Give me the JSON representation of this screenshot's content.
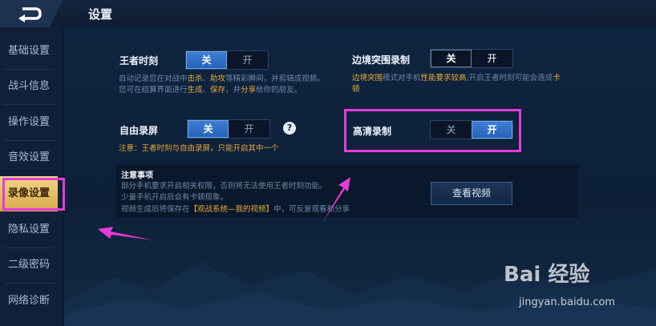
{
  "header": {
    "title": "设置",
    "back_icon": "back-arrow-icon"
  },
  "sidebar": {
    "items": [
      {
        "label": "基础设置"
      },
      {
        "label": "战斗信息"
      },
      {
        "label": "操作设置"
      },
      {
        "label": "音效设置"
      },
      {
        "label": "录像设置",
        "active": true
      },
      {
        "label": "隐私设置"
      },
      {
        "label": "二级密码"
      },
      {
        "label": "网络诊断"
      }
    ]
  },
  "settings": {
    "king_moment": {
      "label": "王者时刻",
      "off": "关",
      "on": "开",
      "state": "off",
      "desc": [
        {
          "t": "自动记录您在对战中"
        },
        {
          "t": "击杀",
          "hl": true
        },
        {
          "t": "、"
        },
        {
          "t": "助攻",
          "hl": true
        },
        {
          "t": "等精彩瞬间，并剪辑成视频。"
        }
      ],
      "desc2": [
        {
          "t": "您可在结算界面进行"
        },
        {
          "t": "生成",
          "hl": true
        },
        {
          "t": "、"
        },
        {
          "t": "保存",
          "hl": true
        },
        {
          "t": "，并"
        },
        {
          "t": "分享",
          "hl": true
        },
        {
          "t": "给你的朋友。"
        }
      ]
    },
    "border_siege": {
      "label": "边境突围录制",
      "off": "关",
      "on": "开",
      "state": "off",
      "desc": [
        {
          "t": "边境突围",
          "hl": true
        },
        {
          "t": "模式对手机"
        },
        {
          "t": "性能要求较高",
          "hl": true
        },
        {
          "t": ",开启王者时刻可能会造成"
        },
        {
          "t": "卡",
          "hl": true
        }
      ],
      "desc2": [
        {
          "t": "顿",
          "hl": true
        }
      ]
    },
    "free_record": {
      "label": "自由录屏",
      "off": "关",
      "on": "开",
      "state": "off",
      "help": "?",
      "warning": "注意：王者时刻与自由录屏，只能开启其中一个"
    },
    "hd_record": {
      "label": "高清录制",
      "off": "关",
      "on": "开",
      "state": "on"
    }
  },
  "notes": {
    "title": "注意事项",
    "line1": "部分手机要求开启相关权限，否则将无法使用王者时刻功能。",
    "line2": "少量手机开启后会有卡顿现象。",
    "line3_prefix": "视频生成后将保存在",
    "line3_highlight": "【观战系统—我的视频】",
    "line3_suffix": "中，可反复观看和分享"
  },
  "button": {
    "view_video": "查看视频"
  },
  "watermark": {
    "brand": "Bai 经验",
    "url": "jingyan.baidu.com"
  },
  "colors": {
    "accent": "#e5a93e",
    "toggle_on": "#2f6fc8",
    "annotation": "#e53bd8",
    "active_tab": "#e3b660"
  }
}
